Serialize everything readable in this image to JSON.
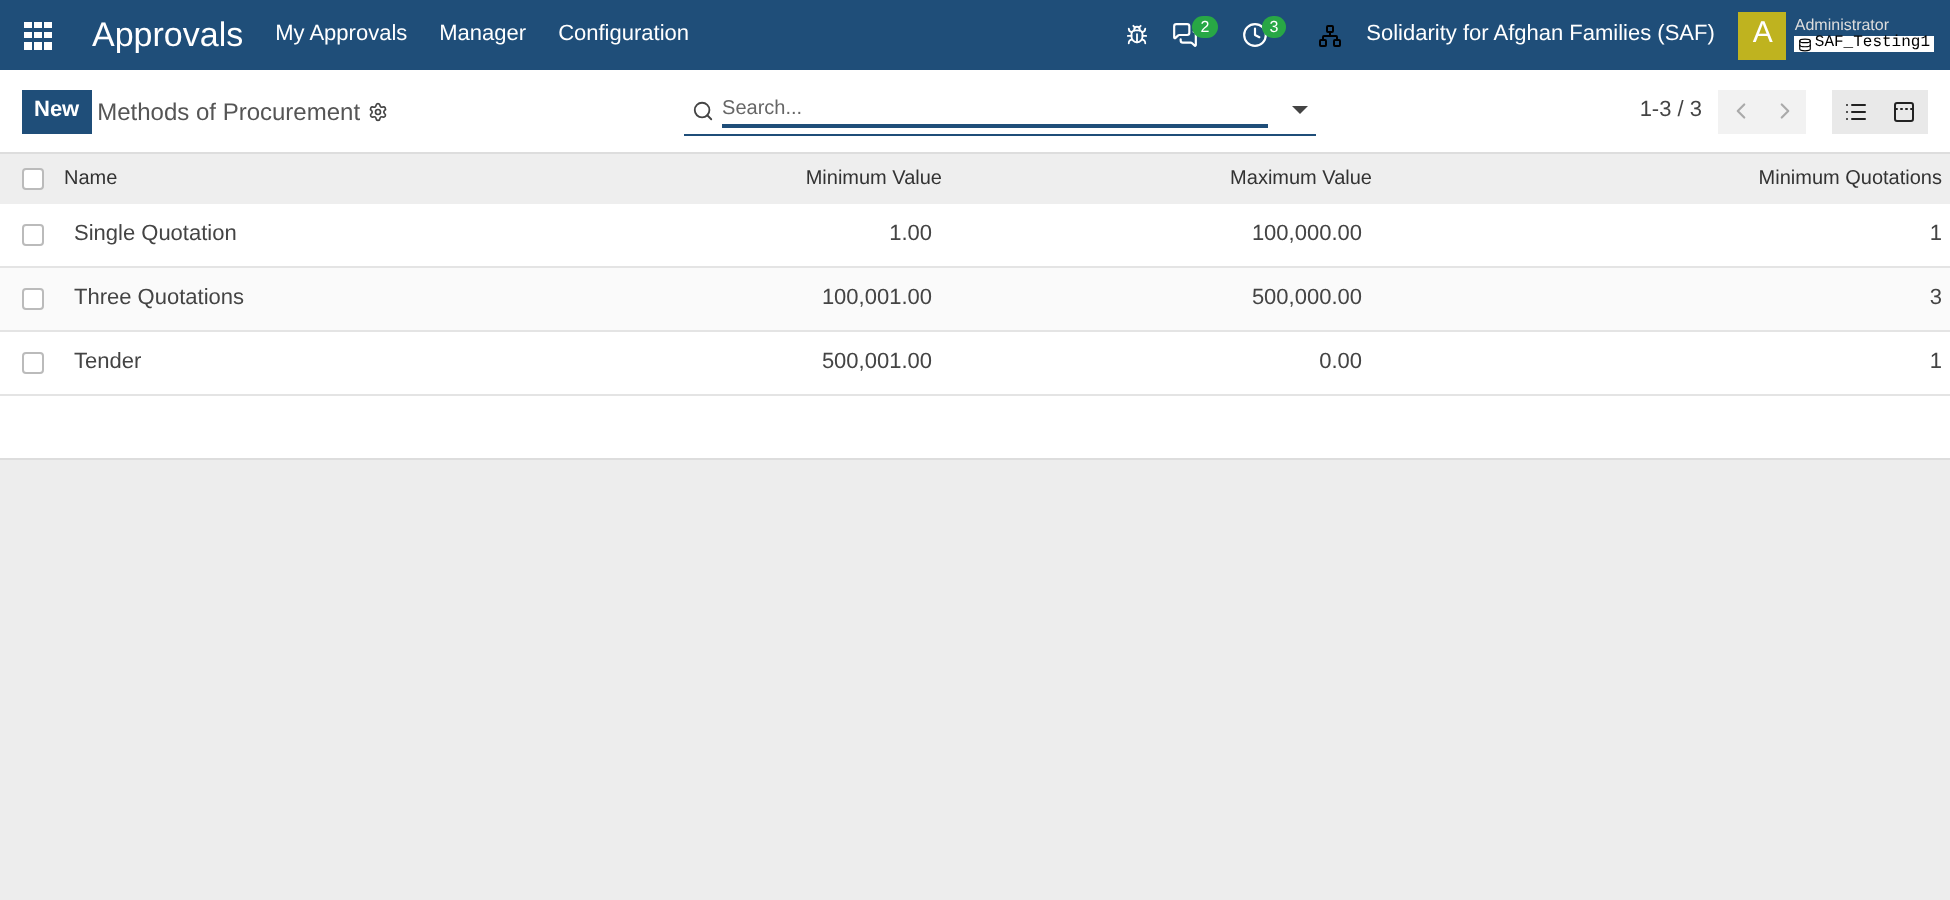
{
  "navbar": {
    "app_name": "Approvals",
    "menu": [
      "My Approvals",
      "Manager",
      "Configuration"
    ],
    "messages_count": "2",
    "activities_count": "3",
    "company": "Solidarity for Afghan Families (SAF)",
    "avatar_letter": "A",
    "user_name": "Administrator",
    "database": "SAF_Testing1"
  },
  "control_panel": {
    "new_button": "New",
    "title": "Methods of Procurement",
    "search": {
      "placeholder": "Search..."
    },
    "pager": "1-3 / 3"
  },
  "table": {
    "columns": [
      "Name",
      "Minimum Value",
      "Maximum Value",
      "Minimum Quotations"
    ],
    "header_checked": false,
    "rows": [
      {
        "checked": false,
        "cells": [
          "Single Quotation",
          "1.00",
          "100,000.00",
          "1"
        ]
      },
      {
        "checked": false,
        "cells": [
          "Three Quotations",
          "100,001.00",
          "500,000.00",
          "3"
        ]
      },
      {
        "checked": false,
        "cells": [
          "Tender",
          "500,001.00",
          "0.00",
          "1"
        ]
      }
    ]
  }
}
